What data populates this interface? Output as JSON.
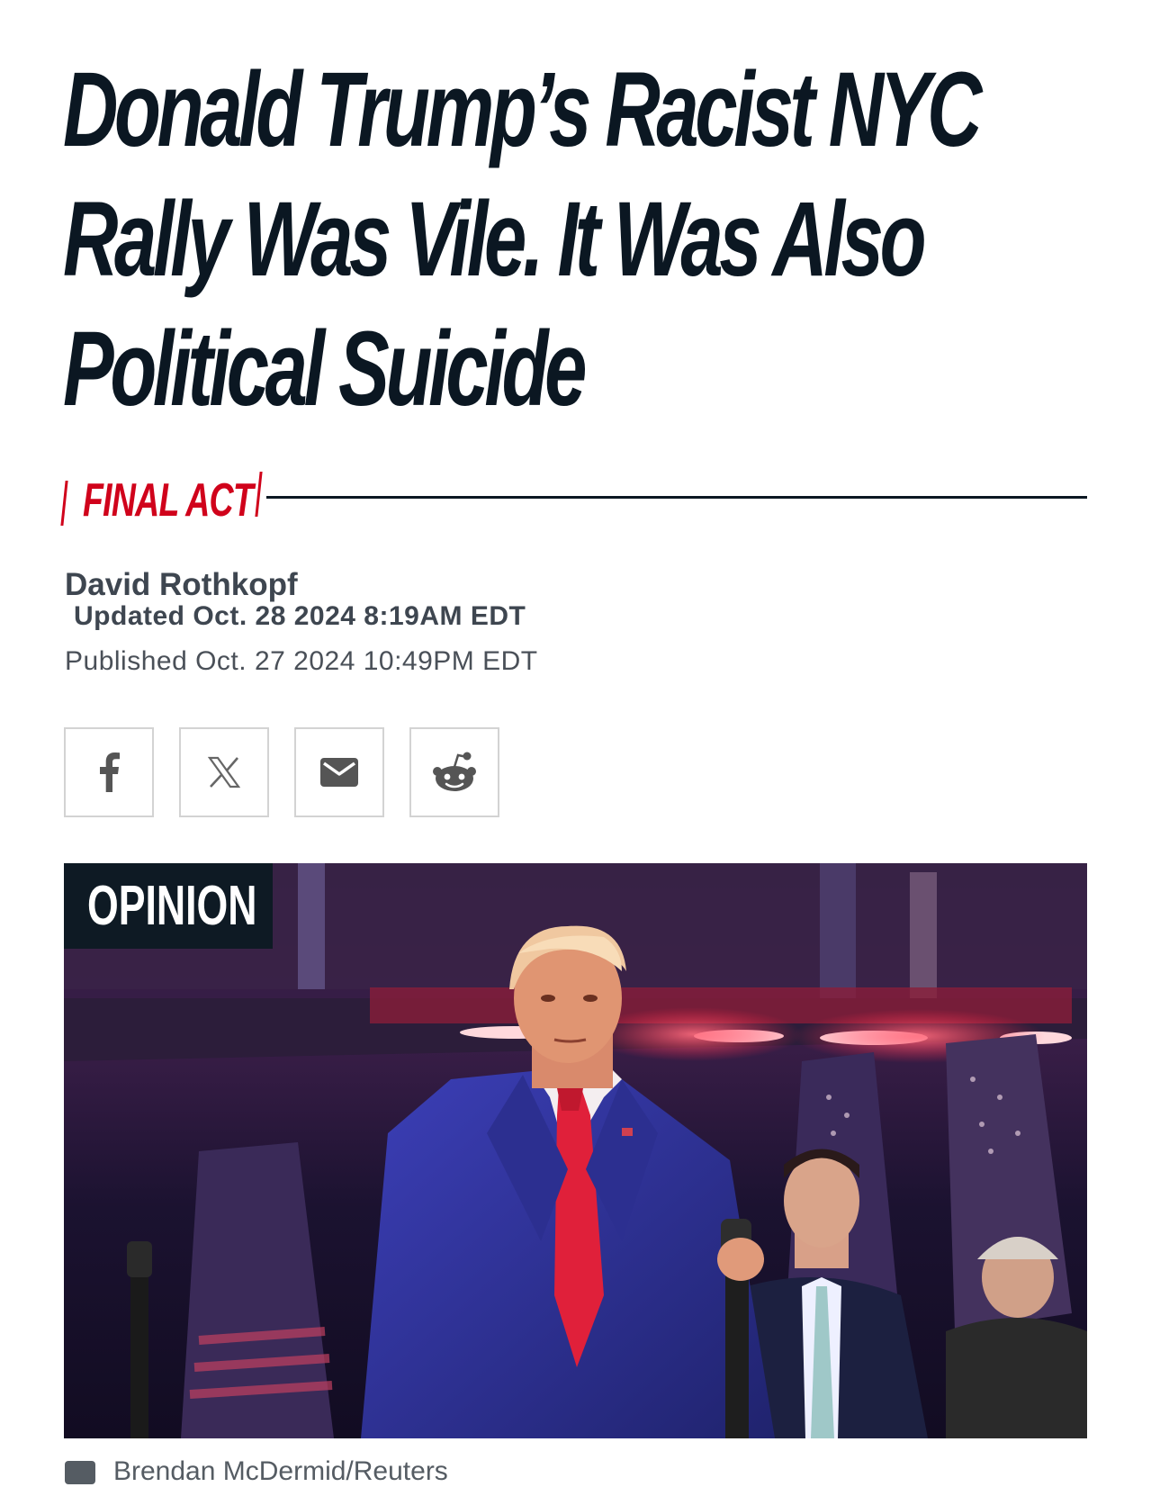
{
  "article": {
    "headline": "Donald Trump’s Racist NYC Rally Was Vile. It Was Also Political Suicide",
    "rubric": "FINAL ACT",
    "author": "David Rothkopf",
    "updated": "Updated Oct. 28 2024 8:19AM EDT",
    "published": "Published Oct. 27 2024 10:49PM EDT"
  },
  "share": {
    "buttons": [
      {
        "icon": "facebook-icon"
      },
      {
        "icon": "x-icon"
      },
      {
        "icon": "email-icon"
      },
      {
        "icon": "reddit-icon"
      }
    ]
  },
  "hero": {
    "badge": "OPINION",
    "caption": "Brendan McDermid/Reuters"
  },
  "colors": {
    "accent_red": "#d0021b",
    "ink": "#0b1722",
    "badge_bg": "#0e1a24",
    "muted_text": "#3e4650"
  }
}
